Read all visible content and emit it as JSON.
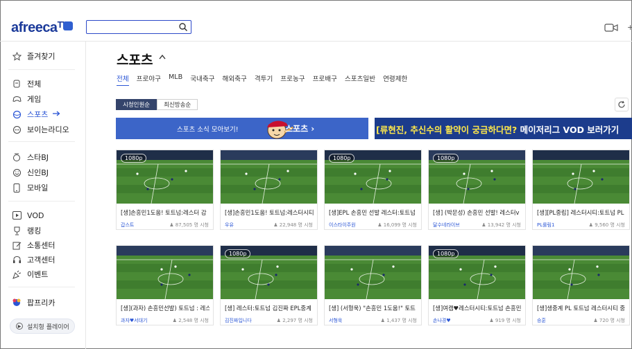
{
  "header": {
    "logo_text": "afreeca",
    "logo_tv": "TV",
    "search_placeholder": "",
    "more_label": "+"
  },
  "sidebar": {
    "items": [
      {
        "label": "즐겨찾기",
        "icon": "star-icon"
      },
      {
        "label": "전체",
        "icon": "all-icon"
      },
      {
        "label": "게임",
        "icon": "gamepad-icon"
      },
      {
        "label": "스포츠",
        "icon": "sports-icon",
        "active": true
      },
      {
        "label": "보이는라디오",
        "icon": "radio-icon"
      },
      {
        "label": "스타BJ",
        "icon": "star-bj-icon"
      },
      {
        "label": "신인BJ",
        "icon": "smile-icon"
      },
      {
        "label": "모바일",
        "icon": "mobile-icon"
      },
      {
        "label": "VOD",
        "icon": "play-icon"
      },
      {
        "label": "랭킹",
        "icon": "trophy-icon"
      },
      {
        "label": "소통센터",
        "icon": "edit-icon"
      },
      {
        "label": "고객센터",
        "icon": "headset-icon"
      },
      {
        "label": "이벤트",
        "icon": "party-icon"
      },
      {
        "label": "팝프리카",
        "icon": "popfreeca-icon"
      }
    ],
    "player_button": "설치형 플레이어"
  },
  "main": {
    "title": "스포츠",
    "categories": [
      "전체",
      "프로야구",
      "MLB",
      "국내축구",
      "해외축구",
      "격투기",
      "프로농구",
      "프로배구",
      "스포츠일반",
      "연령제한"
    ],
    "sort": [
      "시청인원순",
      "최신방송순"
    ],
    "banner1": {
      "text": "스포츠 소식 모아보기!",
      "brand": "스포츠 ›"
    },
    "banner2": {
      "text": "[류현진, 추신수의 활약이 궁금하다면?",
      "tail": " 메이저리그 VOD 보러가기"
    }
  },
  "cards": [
    {
      "title": "[생]손흥민1도움! 토트넘:레스터 감",
      "channel": "갑스트",
      "views": "87,505 명 시청",
      "badge": "1080p"
    },
    {
      "title": "[생]손흥민1도움! 토트넘:레스터시티",
      "channel": "우유",
      "views": "22,948 명 시청",
      "badge": ""
    },
    {
      "title": "[생]EPL 손흥민 선발 레스터:토트넘",
      "channel": "이스타이주원",
      "views": "16,099 명 시청",
      "badge": "1080p"
    },
    {
      "title": "[생] (박문성) 손흥민 선발! 레스터v",
      "channel": "달수네라이브",
      "views": "13,942 명 시청",
      "badge": "1080p"
    },
    {
      "title": "[생][PL중립] 레스터시티:토트넘 PL",
      "channel": "PL룰림1",
      "views": "9,560 명 시청",
      "badge": ""
    },
    {
      "title": "[생](과자) 손흥민선발) 토트넘 : 레스",
      "channel": "과자♥서대기",
      "views": "2,548 명 시청",
      "badge": ""
    },
    {
      "title": "[생] 레스터:토트넘 김진짜 EPL중계",
      "channel": "김진짜입니다",
      "views": "2,297 명 시청",
      "badge": "1080p"
    },
    {
      "title": "[생] (서형욱) \"손흥민 1도움!\" 토트",
      "channel": "서형욱",
      "views": "1,437 명 시청",
      "badge": ""
    },
    {
      "title": "[생]여캠♥레스터시티:토트넘 손흥민",
      "channel": "손나경♥",
      "views": "919 명 시청",
      "badge": "1080p"
    },
    {
      "title": "[생]생중계 PL 토트넘 레스터시티 중",
      "channel": "승훈",
      "views": "720 명 시청",
      "badge": ""
    }
  ]
}
